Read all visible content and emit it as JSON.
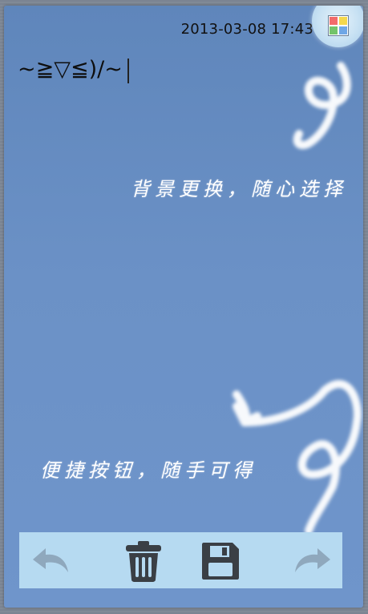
{
  "header": {
    "datetime": "2013-03-08 17:43",
    "background_button_icon": "color-grid-icon"
  },
  "editor": {
    "text": "~≧▽≦)/~"
  },
  "hints": {
    "background": "背景更换，随心选择",
    "buttons": "便捷按钮，随手可得"
  },
  "toolbar": {
    "undo_icon": "undo-arrow-icon",
    "delete_icon": "trash-can-icon",
    "save_icon": "floppy-disk-icon",
    "redo_icon": "redo-arrow-icon"
  },
  "colors": {
    "note_background": "#6b91c6",
    "toolbar_background": "#b6daf1",
    "icon_disabled": "#8fa8bd",
    "icon_active": "#3a3f45",
    "grid_colors": [
      "#f26b6b",
      "#f4d84c",
      "#73c46a",
      "#6fa7e6"
    ]
  }
}
